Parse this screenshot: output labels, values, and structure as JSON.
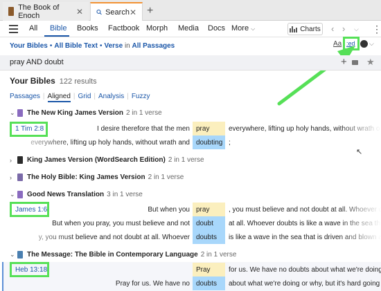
{
  "tabs": [
    {
      "label": "The Book of Enoch"
    },
    {
      "label": "Search"
    }
  ],
  "nav": {
    "items": [
      "All",
      "Bible",
      "Books",
      "Factbook",
      "Morph",
      "Media",
      "Docs",
      "More"
    ],
    "charts_label": "Charts"
  },
  "filter": {
    "your_bibles": "Your Bibles",
    "all_bible_text": "All Bible Text",
    "verse": "Verse",
    "in": "in",
    "all_passages": "All Passages",
    "aa": "Aa",
    "ed": ":ed"
  },
  "query": {
    "text": "pray AND doubt"
  },
  "results": {
    "title": "Your Bibles",
    "count": "122 results"
  },
  "subtabs": [
    "Passages",
    "Aligned",
    "Grid",
    "Analysis",
    "Fuzzy"
  ],
  "groups": [
    {
      "title": "The New King James Version",
      "meta": "2 in 1 verse",
      "ref": "1 Tim 2:8",
      "icon_color": "#8a6bbf",
      "rows": [
        {
          "before": "I desire therefore that the men",
          "hit": "pray",
          "hit_color": "yellow",
          "after": "everywhere, lifting up holy hands, without wrath o"
        },
        {
          "before": "everywhere, lifting up holy hands, without wrath and",
          "hit": "doubting",
          "hit_color": "blue",
          "after": ";"
        }
      ]
    },
    {
      "title": "King James Version (WordSearch Edition)",
      "meta": "2 in 1 verse",
      "icon_color": "#2b2b2b"
    },
    {
      "title": "The Holy Bible: King James Version",
      "meta": "2 in 1 verse",
      "icon_color": "#7a6aa8"
    },
    {
      "title": "Good News Translation",
      "meta": "3 in 1 verse",
      "ref": "James 1:6",
      "icon_color": "#8a6bbf",
      "rows": [
        {
          "before": "But when you",
          "hit": "pray",
          "hit_color": "yellow",
          "after": ", you must believe and not doubt at all. Whoever d"
        },
        {
          "before": "But when you pray, you must believe and not",
          "hit": "doubt",
          "hit_color": "blue",
          "after": "at all. Whoever doubts is like a wave in the sea th"
        },
        {
          "before": "y, you must believe and not doubt at all. Whoever",
          "hit": "doubts",
          "hit_color": "blue",
          "after": "is like a wave in the sea that is driven and blown a"
        }
      ]
    },
    {
      "title": "The Message: The Bible in Contemporary Language",
      "meta": "2 in 1 verse",
      "ref": "Heb 13:18",
      "icon_color": "#4a7fb0",
      "rows": [
        {
          "before": "",
          "hit": "Pray",
          "hit_color": "yellow",
          "after": "for us. We have no doubts about what we're doing"
        },
        {
          "before": "Pray for us. We have no",
          "hit": "doubts",
          "hit_color": "blue",
          "after": "about what we're doing or why, but it's hard going"
        }
      ]
    }
  ]
}
